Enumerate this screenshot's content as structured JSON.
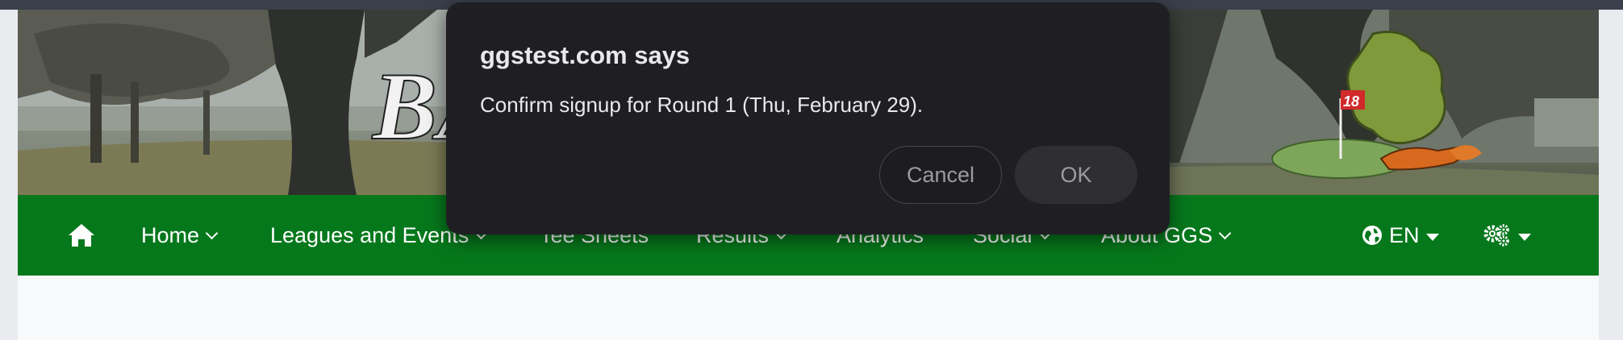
{
  "banner": {
    "partial_logo_text": "BA",
    "flag_number": "18"
  },
  "nav": {
    "items": [
      {
        "label": "Home",
        "has_dropdown": true
      },
      {
        "label": "Leagues and Events",
        "has_dropdown": true
      },
      {
        "label": "Tee Sheets",
        "has_dropdown": false
      },
      {
        "label": "Results",
        "has_dropdown": true
      },
      {
        "label": "Analytics",
        "has_dropdown": false
      },
      {
        "label": "Social",
        "has_dropdown": true
      },
      {
        "label": "About GGS",
        "has_dropdown": true
      }
    ],
    "language": "EN",
    "icons": {
      "home": "home-icon",
      "language": "globe-icon",
      "settings": "gears-icon"
    }
  },
  "dialog": {
    "title": "ggstest.com says",
    "message": "Confirm signup for Round 1 (Thu, February 29).",
    "cancel_label": "Cancel",
    "ok_label": "OK"
  },
  "colors": {
    "navbar": "#06781c",
    "dialog_bg": "#1f1f23",
    "dialog_text": "#e9e9ec",
    "button_text": "#9b9ba0"
  }
}
